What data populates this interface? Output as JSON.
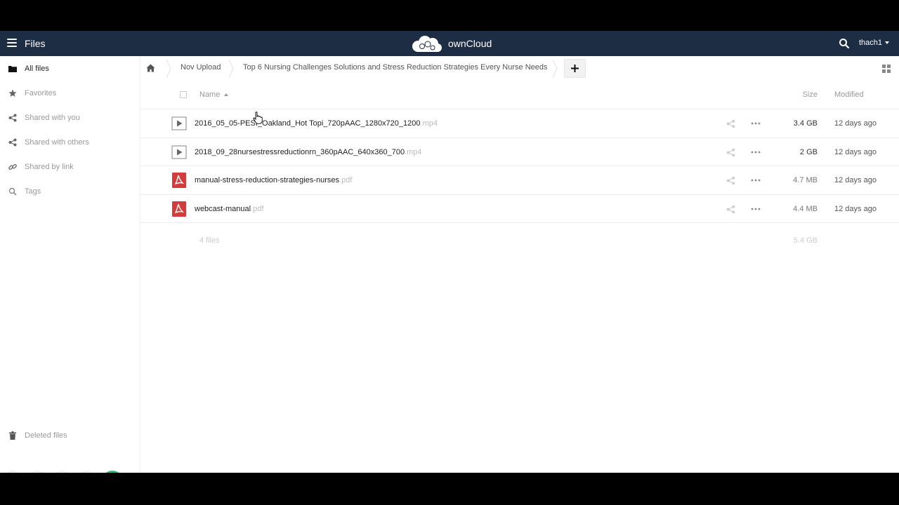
{
  "header": {
    "app_name": "Files",
    "brand": "ownCloud",
    "user": "thach1",
    "bg_color": "#1d2d44"
  },
  "sidebar": {
    "items": [
      {
        "label": "All files",
        "icon": "folder-icon",
        "active": true
      },
      {
        "label": "Favorites",
        "icon": "star-icon"
      },
      {
        "label": "Shared with you",
        "icon": "share-icon"
      },
      {
        "label": "Shared with others",
        "icon": "share-icon"
      },
      {
        "label": "Shared by link",
        "icon": "link-icon"
      },
      {
        "label": "Tags",
        "icon": "search-icon"
      }
    ],
    "deleted_label": "Deleted files"
  },
  "breadcrumbs": {
    "home_icon": "home-icon",
    "items": [
      "Nov Upload",
      "Top 6 Nursing Challenges Solutions and Stress Reduction Strategies Every Nurse Needs"
    ],
    "new_button": "+"
  },
  "table": {
    "columns": {
      "name": "Name",
      "size": "Size",
      "modified": "Modified"
    },
    "rows": [
      {
        "name": "2016_05_05-PESI_Oakland_Hot Topi_720pAAC_1280x720_1200",
        "ext": ".mp4",
        "type": "video",
        "size": "3.4 GB",
        "modified": "12 days ago"
      },
      {
        "name": "2018_09_28nursestressreductionrn_360pAAC_640x360_700",
        "ext": ".mp4",
        "type": "video",
        "size": "2 GB",
        "modified": "12 days ago"
      },
      {
        "name": "manual-stress-reduction-strategies-nurses",
        "ext": ".pdf",
        "type": "pdf",
        "size": "4.7 MB",
        "modified": "12 days ago"
      },
      {
        "name": "webcast-manual",
        "ext": ".pdf",
        "type": "pdf",
        "size": "4.4 MB",
        "modified": "12 days ago"
      }
    ],
    "summary": {
      "count": "4 files",
      "total": "5.4 GB"
    }
  },
  "colors": {
    "pdf": "#d33c3c",
    "accept": "#20c35f",
    "cancel": "#e05656"
  }
}
